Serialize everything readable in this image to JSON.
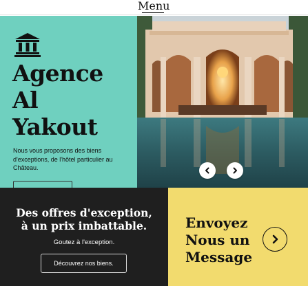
{
  "nav": {
    "menu_label": "Menu"
  },
  "hero": {
    "icon": "bank-building-icon",
    "title_line1": "Agence",
    "title_line2": "Al",
    "title_line3": "Yakout",
    "description": "Nous vous proposons des biens d'exceptions, de l'hôtel particulier au Château.",
    "cta_label": "",
    "carousel": {
      "prev_icon": "chevron-left-icon",
      "next_icon": "chevron-right-icon"
    }
  },
  "offer": {
    "title_line1": "Des offres d'exception,",
    "title_line2": "à un prix imbattable.",
    "subtitle": "Goutez à l'exception.",
    "button_label": "Découvrez nos biens."
  },
  "contact": {
    "title_line1": "Envoyez",
    "title_line2": "Nous un",
    "title_line3": "Message",
    "arrow_icon": "chevron-right-icon"
  },
  "colors": {
    "hero_bg": "#6fd0bf",
    "offer_bg": "#1f1f1f",
    "contact_bg": "#f2db6e",
    "text_dark": "#111111"
  }
}
